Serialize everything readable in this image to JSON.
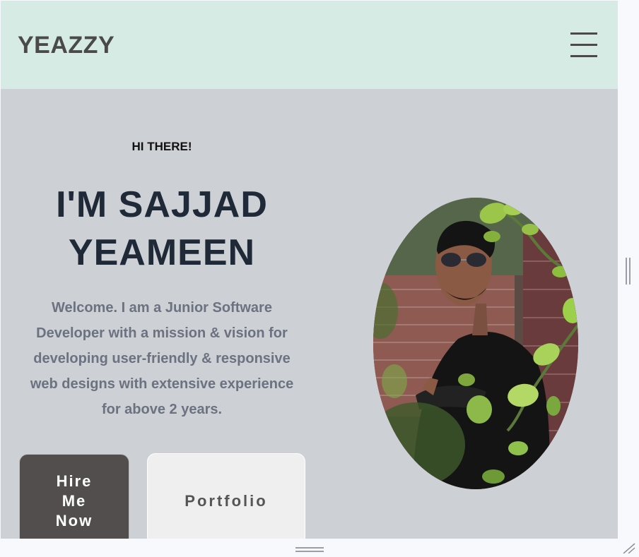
{
  "navbar": {
    "brand": "YEAZZY",
    "menu_icon": "hamburger-menu-icon",
    "background": "#d5ebe3"
  },
  "hero": {
    "eyebrow": "HI THERE!",
    "headline_line1": "I'M SAJJAD",
    "headline_line2": "YEAMEEN",
    "intro": "Welcome. I am a Junior Software Developer with a mission & vision for developing user-friendly & responsive web designs with extensive experience for above 2 years.",
    "background": "#cdd0d5"
  },
  "buttons": {
    "hire_line1": "Hire",
    "hire_line2": "Me",
    "hire_line3": "Now",
    "portfolio": "Portfolio"
  },
  "colors": {
    "headline": "#1f2937",
    "intro_text": "#6b7280",
    "hire_button": "#524e4e",
    "portfolio_button": "#efefef"
  },
  "icons": {
    "profile_photo": "profile-photo",
    "vertical_drag": "vertical-resize-handle-icon",
    "horizontal_drag": "horizontal-resize-handle-icon",
    "corner_resize": "corner-resize-grip-icon"
  }
}
